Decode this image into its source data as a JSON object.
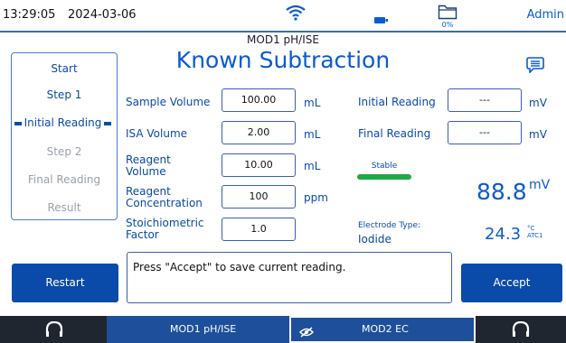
{
  "status": {
    "time": "13:29:05",
    "date": "2024-03-06",
    "folder_percent": "0%",
    "user": "Admin"
  },
  "header": {
    "module": "MOD1 pH/ISE",
    "title": "Known Subtraction"
  },
  "steps": [
    {
      "label": "Start",
      "state": "done"
    },
    {
      "label": "Step 1",
      "state": "done"
    },
    {
      "label": "Initial Reading",
      "state": "current"
    },
    {
      "label": "Step 2",
      "state": "pending"
    },
    {
      "label": "Final Reading",
      "state": "pending"
    },
    {
      "label": "Result",
      "state": "pending"
    }
  ],
  "fields": {
    "sample_volume": {
      "label": "Sample Volume",
      "value": "100.00",
      "unit": "mL"
    },
    "isa_volume": {
      "label": "ISA Volume",
      "value": "2.00",
      "unit": "mL"
    },
    "reagent_volume": {
      "label": "Reagent Volume",
      "value": "10.00",
      "unit": "mL"
    },
    "reagent_concentration": {
      "label": "Reagent Concentration",
      "value": "100",
      "unit": "ppm"
    },
    "stoichiometric_factor": {
      "label": "Stoichiometric Factor",
      "value": "1.0"
    },
    "initial_reading": {
      "label": "Initial Reading",
      "value": "---",
      "unit": "mV"
    },
    "final_reading": {
      "label": "Final Reading",
      "value": "---",
      "unit": "mV"
    }
  },
  "stability": {
    "label": "Stable",
    "color": "#1fa84a"
  },
  "measurement": {
    "value": "88.8",
    "unit": "mV"
  },
  "temperature": {
    "value": "24.3",
    "unit": "°C",
    "source": "ATC1"
  },
  "electrode": {
    "label": "Electrode Type:",
    "value": "Iodide"
  },
  "message": "Press \"Accept\" to save current reading.",
  "buttons": {
    "restart": "Restart",
    "accept": "Accept"
  },
  "bottom_bar": {
    "module1": "MOD1 pH/ISE",
    "module2": "MOD2 EC"
  },
  "colors": {
    "accent": "#0a5bd1",
    "button": "#0a4aa8",
    "stable": "#1fa84a"
  }
}
